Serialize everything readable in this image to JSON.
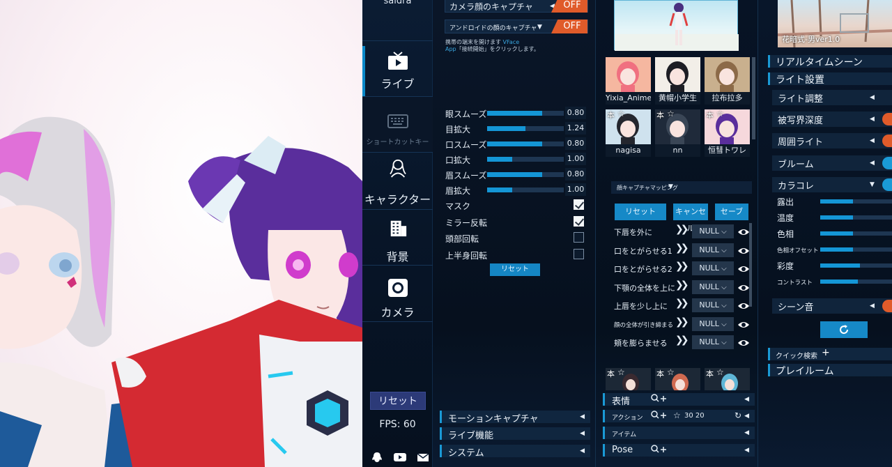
{
  "nav": {
    "user": "saidra",
    "items": [
      {
        "label": "ライブ",
        "icon": "tv-icon"
      },
      {
        "label": "ショートカットキー",
        "icon": "keyboard-icon"
      },
      {
        "label": "キャラクター",
        "icon": "character-icon"
      },
      {
        "label": "背景",
        "icon": "building-icon"
      },
      {
        "label": "カメラ",
        "icon": "camera-icon"
      }
    ],
    "reset_label": "リセット",
    "fps_text": "FPS: 60",
    "footer_icons": [
      "qq-icon",
      "youtube-icon",
      "mail-icon"
    ]
  },
  "face_capture": {
    "camera_capture_label": "カメラ顔のキャプチャ",
    "camera_capture_state": "OFF",
    "android_capture_label": "アンドロイドの顔のキャプチャ",
    "android_capture_state": "OFF",
    "note_line1_a": "携帯の端末を開けます ",
    "note_line1_b": "VFace",
    "note_line2_a": "App",
    "note_line2_b": "「接続開始」をクリックします。",
    "sliders": [
      {
        "label": "眼スムーズ",
        "value": "0.80",
        "fraction": 0.72
      },
      {
        "label": "目拡大",
        "value": "1.24",
        "fraction": 0.5
      },
      {
        "label": "口スムーズ",
        "value": "0.80",
        "fraction": 0.72
      },
      {
        "label": "口拡大",
        "value": "1.00",
        "fraction": 0.33
      },
      {
        "label": "眉スムーズ",
        "value": "0.80",
        "fraction": 0.72
      },
      {
        "label": "眉拡大",
        "value": "1.00",
        "fraction": 0.33
      }
    ],
    "checks": [
      {
        "label": "マスク",
        "checked": true
      },
      {
        "label": "ミラー反転",
        "checked": true
      },
      {
        "label": "頭部回転",
        "checked": false
      },
      {
        "label": "上半身回転",
        "checked": false
      }
    ],
    "reset_label": "リセット"
  },
  "bottom_menu": [
    {
      "label": "モーションキャプチャ"
    },
    {
      "label": "ライブ機能"
    },
    {
      "label": "システム"
    }
  ],
  "characters": {
    "grid": [
      {
        "name": "Yixia_Anime",
        "tag": "anime"
      },
      {
        "name": "黄帽小学生"
      },
      {
        "name": "拉布拉多"
      },
      {
        "name": "nagisa",
        "badge": "本",
        "star": "☆"
      },
      {
        "name": "nn",
        "badge": "本",
        "star": "☆"
      },
      {
        "name": "恒彗トワレ",
        "badge": "本",
        "star": "☆"
      }
    ],
    "mapping_label": "顔キャプチャマッピング",
    "buttons": {
      "reset": "リセット",
      "cancel": "キャンセル",
      "save": "セーブ"
    },
    "mappings": [
      {
        "label": "下唇を外に",
        "value": "NULL"
      },
      {
        "label": "口をとがらせる1",
        "value": "NULL"
      },
      {
        "label": "口をとがらせる2",
        "value": "NULL"
      },
      {
        "label": "下顎の全体を上に",
        "value": "NULL"
      },
      {
        "label": "上唇を少し上に",
        "value": "NULL"
      },
      {
        "label": "顔の全体が引き締まる",
        "value": "NULL",
        "small": true
      },
      {
        "label": "頬を膨らませる",
        "value": "NULL"
      }
    ],
    "bottom_thumbs": [
      {
        "badge": "本",
        "star": "☆"
      },
      {
        "badge": "本",
        "star": "☆"
      },
      {
        "badge": "本",
        "star": "☆"
      }
    ],
    "bars": [
      {
        "label": "表情",
        "tools": "🔍+"
      },
      {
        "label": "アクション",
        "tools": "🔍+ ☆ 30 20 ↻"
      },
      {
        "label": "アイテム",
        "tools": ""
      },
      {
        "label": "Pose",
        "tools": "🔍+"
      }
    ]
  },
  "scene": {
    "thumb_caption": "花暗式-男ver1.0",
    "headers": [
      "リアルタイムシーン",
      "ライト設置"
    ],
    "rows": [
      {
        "label": "ライト調整",
        "toggle_color": ""
      },
      {
        "label": "被写界深度",
        "toggle_color": "#e05b2a"
      },
      {
        "label": "周囲ライト",
        "toggle_color": "#e05b2a"
      },
      {
        "label": "ブルーム",
        "toggle_color": "#1a9ad6"
      },
      {
        "label": "カラコレ",
        "toggle_color": "#1a9ad6"
      }
    ],
    "sliders": [
      {
        "label": "露出",
        "fraction": 0.45
      },
      {
        "label": "温度",
        "fraction": 0.45
      },
      {
        "label": "色相",
        "fraction": 0.45
      },
      {
        "label": "色相オフセット",
        "fraction": 0.45,
        "small": true
      },
      {
        "label": "彩度",
        "fraction": 0.55
      },
      {
        "label": "コントラスト",
        "fraction": 0.52,
        "small": true
      }
    ],
    "scene_sound_label": "シーン音",
    "scene_sound_toggle": "#e05b2a",
    "quick_search_label": "クイック検索",
    "playroom_label": "プレイルーム"
  },
  "colors": {
    "accent": "#1a9ad6",
    "off": "#e05b2a",
    "button": "#1689c7",
    "panel": "#10263f"
  }
}
